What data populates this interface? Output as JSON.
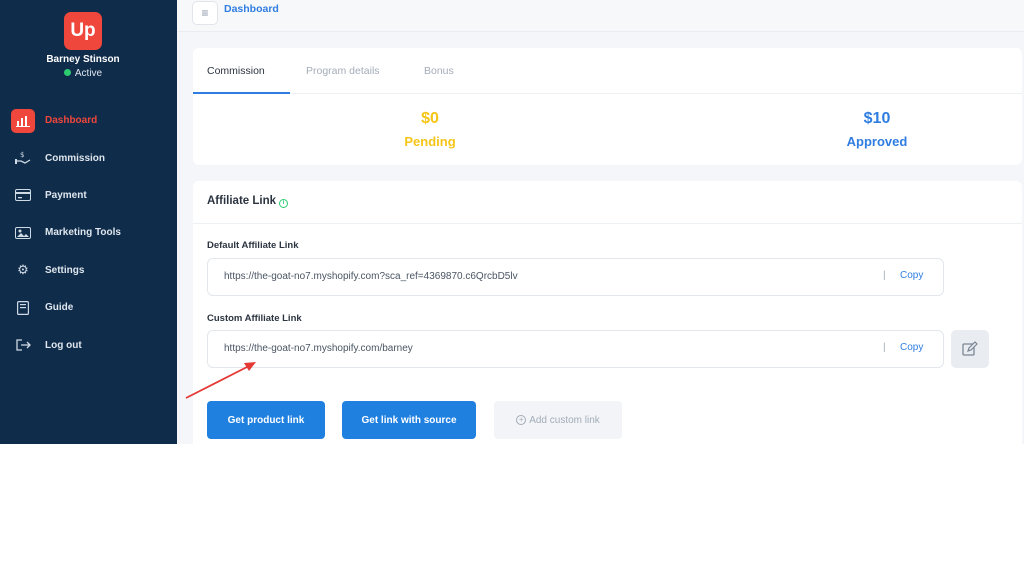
{
  "sidebar": {
    "logo_text": "Up",
    "user_name": "Barney Stinson",
    "user_status": "Active",
    "items": [
      {
        "label": "Dashboard",
        "icon": "chart-bars-icon",
        "active": true
      },
      {
        "label": "Commission",
        "icon": "hand-coin-icon"
      },
      {
        "label": "Payment",
        "icon": "credit-card-icon"
      },
      {
        "label": "Marketing Tools",
        "icon": "image-icon"
      },
      {
        "label": "Settings",
        "icon": "gear-icon"
      },
      {
        "label": "Guide",
        "icon": "book-icon"
      },
      {
        "label": "Log out",
        "icon": "logout-icon"
      }
    ]
  },
  "topbar": {
    "breadcrumb": "Dashboard"
  },
  "commission_card": {
    "tabs": [
      {
        "label": "Commission",
        "active": true
      },
      {
        "label": "Program details"
      },
      {
        "label": "Bonus"
      }
    ],
    "pending": {
      "value": "$0",
      "label": "Pending"
    },
    "approved": {
      "value": "$10",
      "label": "Approved"
    }
  },
  "affiliate": {
    "title": "Affiliate Link",
    "default_label": "Default Affiliate Link",
    "default_link": "https://the-goat-no7.myshopify.com?sca_ref=4369870.c6QrcbD5lv",
    "custom_label": "Custom Affiliate Link",
    "custom_link": "https://the-goat-no7.myshopify.com/barney",
    "separator": "|",
    "copy_label": "Copy",
    "buttons": {
      "product_link": "Get product link",
      "link_with_source": "Get link with source",
      "add_custom": "Add custom link"
    }
  },
  "colors": {
    "sidebar_bg": "#0f2c4a",
    "accent_red": "#f0473c",
    "primary_blue": "#1f80e0",
    "pending_yellow": "#f5c518",
    "annotation_arrow": "#e53935"
  }
}
